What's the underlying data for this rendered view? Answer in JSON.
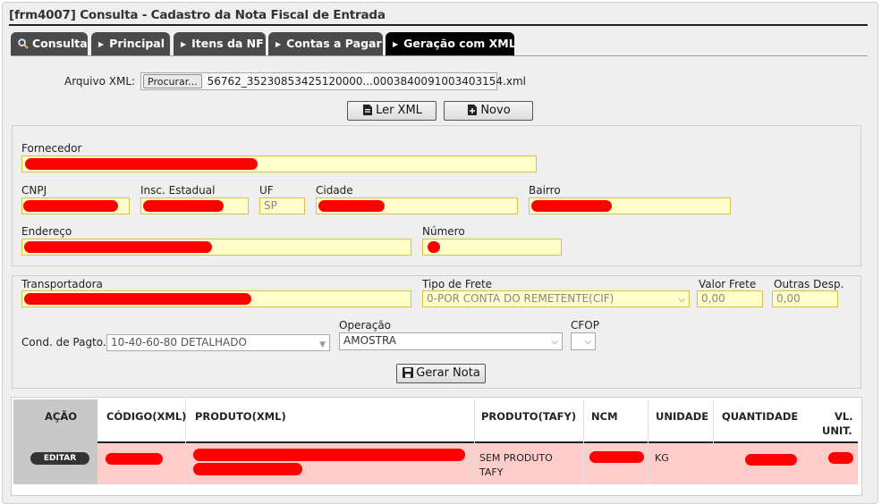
{
  "window": {
    "title": "[frm4007] Consulta - Cadastro da Nota Fiscal de Entrada"
  },
  "tabs": [
    {
      "label": "Consulta",
      "icon": "search-icon"
    },
    {
      "label": "Principal",
      "icon": "triangle-right-icon"
    },
    {
      "label": "Itens da NF",
      "icon": "triangle-right-icon"
    },
    {
      "label": "Contas a Pagar",
      "icon": "triangle-right-icon"
    },
    {
      "label": "Geração com XML",
      "icon": "triangle-right-icon",
      "active": true
    }
  ],
  "xml": {
    "label": "Arquivo XML:",
    "browse": "Procurar...",
    "filename": "56762_35230853425120000...0003840091003403154.xml",
    "read_button": "Ler XML",
    "new_button": "Novo"
  },
  "supplier": {
    "fornecedor_label": "Fornecedor",
    "cnpj_label": "CNPJ",
    "ie_label": "Insc. Estadual",
    "uf_label": "UF",
    "uf_value": "SP",
    "cidade_label": "Cidade",
    "bairro_label": "Bairro",
    "endereco_label": "Endereço",
    "numero_label": "Número"
  },
  "freight": {
    "transportadora_label": "Transportadora",
    "tipo_frete_label": "Tipo de Frete",
    "tipo_frete_value": "0-POR CONTA DO REMETENTE(CIF)",
    "valor_frete_label": "Valor Frete",
    "valor_frete_value": "0,00",
    "outras_label": "Outras Desp.",
    "outras_value": "0,00",
    "cond_label": "Cond. de Pagto.",
    "cond_value": "10-40-60-80 DETALHADO",
    "operacao_label": "Operação",
    "operacao_value": "AMOSTRA",
    "cfop_label": "CFOP",
    "gerar_button": "Gerar Nota"
  },
  "grid": {
    "headers": {
      "acao": "AÇÃO",
      "codigo": "CÓDIGO(XML)",
      "produto_xml": "PRODUTO(XML)",
      "produto_tafy": "PRODUTO(TAFY)",
      "ncm": "NCM",
      "unidade": "UNIDADE",
      "quantidade": "QUANTIDADE",
      "vl_unit_1": "VL.",
      "vl_unit_2": "UNIT."
    },
    "rows": [
      {
        "action": "EDITAR",
        "produto_tafy_1": "SEM PRODUTO",
        "produto_tafy_2": "TAFY",
        "unidade": "KG"
      }
    ]
  },
  "colors": {
    "tab_bg": "#4a4a4a",
    "tab_active": "#000000",
    "field_bg": "#ffffcc",
    "row_bg": "#ffcccc",
    "redaction": "#ff0000"
  }
}
